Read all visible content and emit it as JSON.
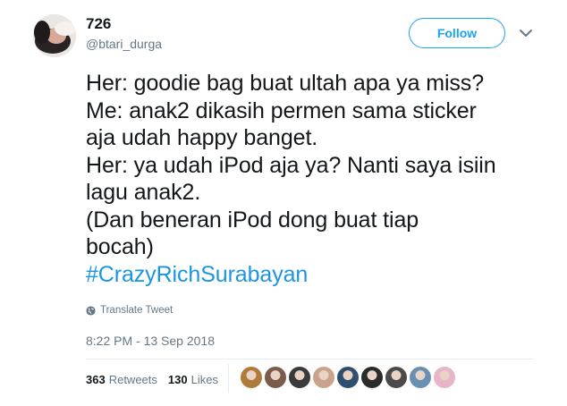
{
  "author": {
    "display_name": "726",
    "handle": "@btari_durga"
  },
  "follow_label": "Follow",
  "tweet": {
    "lines": [
      "Her: goodie bag buat ultah apa ya miss?",
      "Me: anak2 dikasih permen sama sticker",
      "aja udah happy banget.",
      "Her: ya udah iPod aja ya? Nanti saya isiin",
      "lagu anak2.",
      "(Dan beneran iPod dong buat tiap",
      "bocah)"
    ],
    "hashtag": "#CrazyRichSurabayan"
  },
  "translate_label": "Translate Tweet",
  "timestamp": "8:22 PM - 13 Sep 2018",
  "stats": {
    "retweets_count": "363",
    "retweets_label": "Retweets",
    "likes_count": "130",
    "likes_label": "Likes"
  },
  "colors": {
    "accent": "#1da1f2",
    "hashtag": "#1b95e0",
    "muted": "#657786",
    "text": "#14171a"
  },
  "likers": [
    {
      "color": "#b07a3a"
    },
    {
      "color": "#7a5b4c"
    },
    {
      "color": "#3b3b3b"
    },
    {
      "color": "#c9a48a"
    },
    {
      "color": "#2f4f6f"
    },
    {
      "color": "#2b2b2b"
    },
    {
      "color": "#4a4a4a"
    },
    {
      "color": "#6a8fb5"
    },
    {
      "color": "#e8b4c8"
    }
  ]
}
